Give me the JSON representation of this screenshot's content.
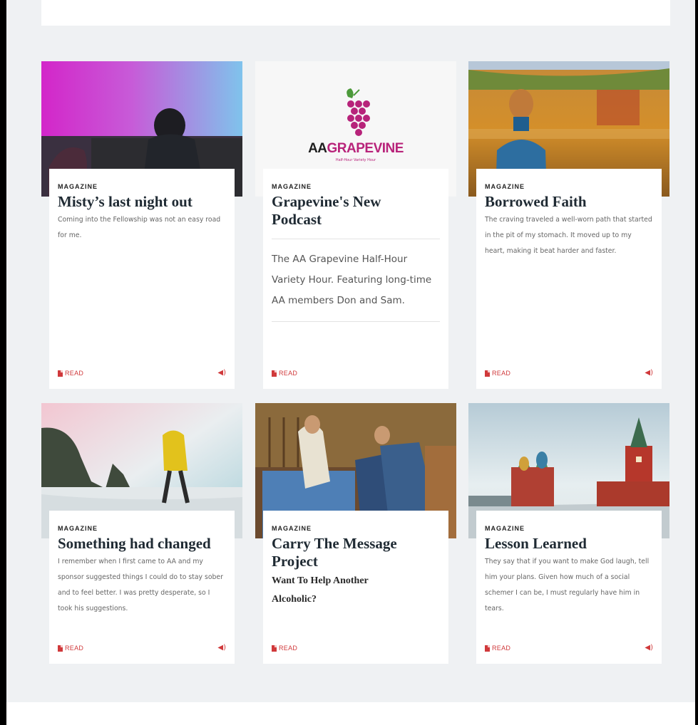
{
  "cards": [
    {
      "category": "MAGAZINE",
      "title": "Misty’s last night out",
      "excerpt": "Coming into the Fellowship was not an easy road for me.",
      "read_label": "READ",
      "has_audio": true
    },
    {
      "category": "MAGAZINE",
      "title": "Grapevine's New Podcast",
      "excerpt": "The AA Grapevine Half-Hour Variety Hour. Featuring long-time AA members Don and Sam.",
      "read_label": "READ",
      "has_audio": false,
      "logo": {
        "prefix": "AA",
        "name": "GRAPEVINE",
        "tagline": "Half-Hour Variety Hour"
      }
    },
    {
      "category": "MAGAZINE",
      "title": "Borrowed Faith",
      "excerpt": "The craving traveled a well-worn path that started in the pit of my stomach. It moved up to my heart, making it beat harder and faster.",
      "read_label": "READ",
      "has_audio": true
    },
    {
      "category": "MAGAZINE",
      "title": "Something had changed",
      "excerpt": "I remember when I first came to AA and my sponsor suggested things I could do to stay sober and to feel better. I was pretty desperate, so I took his suggestions.",
      "read_label": "READ",
      "has_audio": true
    },
    {
      "category": "MAGAZINE",
      "title": "Carry The Message Project",
      "subtitle": "Want To Help Another Alcoholic?",
      "read_label": "READ",
      "has_audio": false
    },
    {
      "category": "MAGAZINE",
      "title": "Lesson Learned",
      "excerpt": "They say that if you want to make God laugh, tell him your plans. Given how much of a social schemer I can be, I must regularly have him in tears.",
      "read_label": "READ",
      "has_audio": true
    }
  ],
  "icons": {
    "read": "document-icon",
    "audio": "speaker-icon"
  },
  "colors": {
    "accent": "#d0393b",
    "background": "#eff1f3"
  }
}
